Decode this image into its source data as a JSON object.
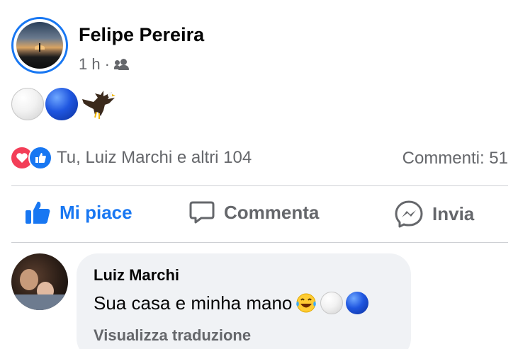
{
  "post": {
    "author": "Felipe Pereira",
    "time": "1 h",
    "separator": "·",
    "audience_icon": "friends-icon",
    "content_emojis": [
      "white-circle",
      "blue-circle",
      "eagle"
    ]
  },
  "reactions": {
    "icons": [
      "love",
      "like"
    ],
    "summary": "Tu, Luiz Marchi e altri 104",
    "comments": "Commenti: 51"
  },
  "actions": {
    "like_label": "Mi piace",
    "comment_label": "Commenta",
    "send_label": "Invia"
  },
  "comment": {
    "author": "Luiz Marchi",
    "text": "Sua casa e minha mano",
    "trailing_emojis": [
      "laughing-tears",
      "white-circle",
      "blue-circle"
    ],
    "translate_label": "Visualizza traduzione"
  },
  "colors": {
    "accent": "#1877f2",
    "secondary_text": "#65676b",
    "love": "#f33e58",
    "bubble": "#f0f2f5"
  }
}
